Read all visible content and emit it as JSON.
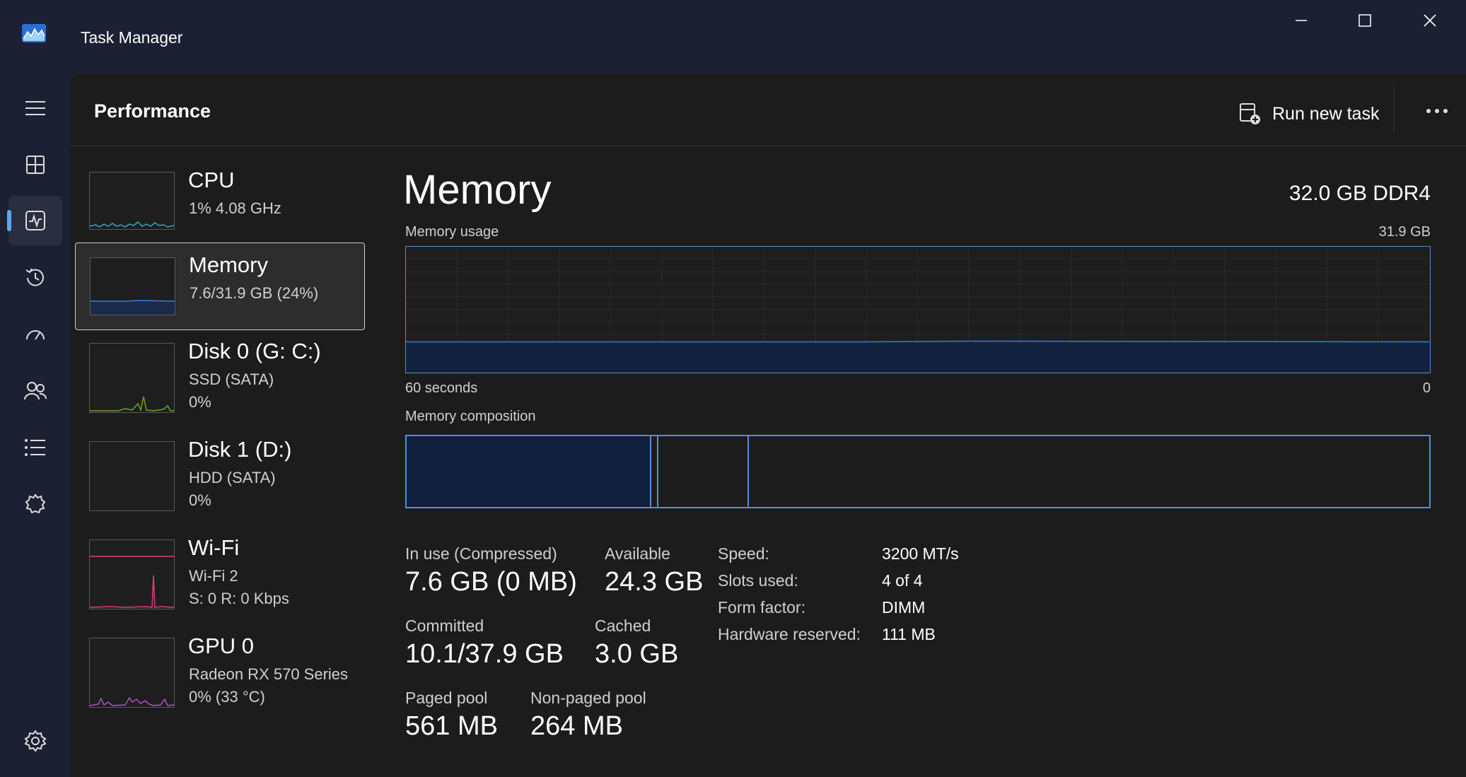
{
  "app": {
    "title": "Task Manager"
  },
  "header": {
    "title": "Performance",
    "run_new_task": "Run new task"
  },
  "colors": {
    "accent": "#5aa8f0",
    "memory": "#3a7bd5",
    "disk": "#6ea22a",
    "wifi": "#d94080",
    "gpu": "#b24fd1",
    "cpu": "#3aa6c8"
  },
  "sidebar_icons": [
    "hamburger-icon",
    "processes-icon",
    "performance-icon",
    "app-history-icon",
    "startup-apps-icon",
    "users-icon",
    "details-icon",
    "services-icon",
    "settings-icon"
  ],
  "tiles": [
    {
      "name": "CPU",
      "line1": "1%  4.08 GHz",
      "line2": ""
    },
    {
      "name": "Memory",
      "line1": "7.6/31.9 GB (24%)",
      "line2": ""
    },
    {
      "name": "Disk 0 (G: C:)",
      "line1": "SSD (SATA)",
      "line2": "0%"
    },
    {
      "name": "Disk 1 (D:)",
      "line1": "HDD (SATA)",
      "line2": "0%"
    },
    {
      "name": "Wi-Fi",
      "line1": "Wi-Fi 2",
      "line2": "S: 0  R: 0 Kbps"
    },
    {
      "name": "GPU 0",
      "line1": "Radeon RX 570 Series",
      "line2": "0%  (33 °C)"
    }
  ],
  "detail": {
    "title": "Memory",
    "spec": "32.0 GB DDR4",
    "usage_label": "Memory usage",
    "usage_max": "31.9 GB",
    "usage_fraction": 0.24,
    "x_left": "60 seconds",
    "x_right": "0",
    "composition_label": "Memory composition",
    "stats": {
      "in_use_label": "In use (Compressed)",
      "in_use_value": "7.6 GB (0 MB)",
      "available_label": "Available",
      "available_value": "24.3 GB",
      "committed_label": "Committed",
      "committed_value": "10.1/37.9 GB",
      "cached_label": "Cached",
      "cached_value": "3.0 GB",
      "paged_label": "Paged pool",
      "paged_value": "561 MB",
      "nonpaged_label": "Non-paged pool",
      "nonpaged_value": "264 MB"
    },
    "specs": [
      {
        "label": "Speed:",
        "value": "3200 MT/s"
      },
      {
        "label": "Slots used:",
        "value": "4 of 4"
      },
      {
        "label": "Form factor:",
        "value": "DIMM"
      },
      {
        "label": "Hardware reserved:",
        "value": "111 MB"
      }
    ]
  }
}
